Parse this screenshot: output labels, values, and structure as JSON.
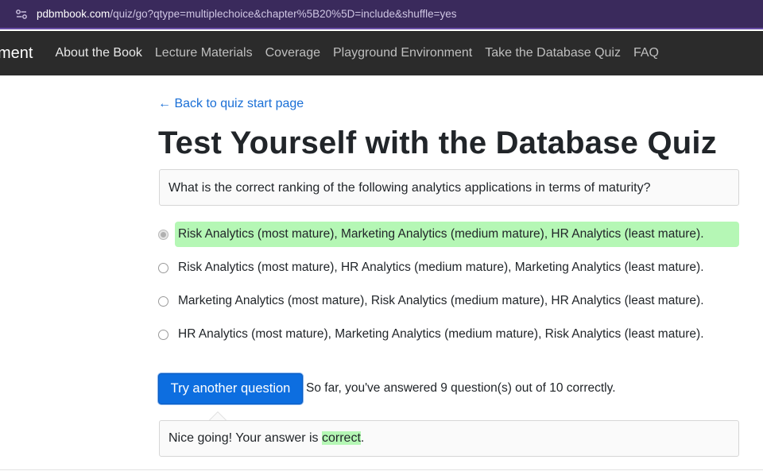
{
  "browser": {
    "url_host": "pdbmbook.com",
    "url_path": "/quiz/go?qtype=multiplechoice&chapter%5B20%5D=include&shuffle=yes",
    "site_info_icon": "tune-icon"
  },
  "navbar": {
    "brand": "ment",
    "items": [
      {
        "label": "About the Book"
      },
      {
        "label": "Lecture Materials"
      },
      {
        "label": "Coverage"
      },
      {
        "label": "Playground Environment"
      },
      {
        "label": "Take the Database Quiz"
      },
      {
        "label": "FAQ"
      }
    ]
  },
  "main": {
    "back_link": "← Back to quiz start page",
    "title": "Test Yourself with the Database Quiz",
    "question": "What is the correct ranking of the following analytics applications in terms of maturity?",
    "options": [
      {
        "label": "Risk Analytics (most mature), Marketing Analytics (medium mature), HR Analytics (least mature).",
        "selected": true,
        "correct": true
      },
      {
        "label": "Risk Analytics (most mature), HR Analytics (medium mature), Marketing Analytics (least mature).",
        "selected": false,
        "correct": false
      },
      {
        "label": "Marketing Analytics (most mature), Risk Analytics (medium mature), HR Analytics (least mature).",
        "selected": false,
        "correct": false
      },
      {
        "label": "HR Analytics (most mature), Marketing Analytics (medium mature), Risk Analytics (least mature).",
        "selected": false,
        "correct": false
      }
    ],
    "try_button": "Try another question",
    "score_text": "So far, you've answered 9 question(s) out of 10 correctly.",
    "feedback": {
      "prefix": "Nice going! Your answer is ",
      "highlight": "correct",
      "suffix": "."
    }
  },
  "colors": {
    "address_bar": "#3a2a5c",
    "navbar": "#2b2b2b",
    "link": "#1a6fd6",
    "primary_button": "#0d6ee0",
    "correct_highlight": "#b5f7b5"
  }
}
